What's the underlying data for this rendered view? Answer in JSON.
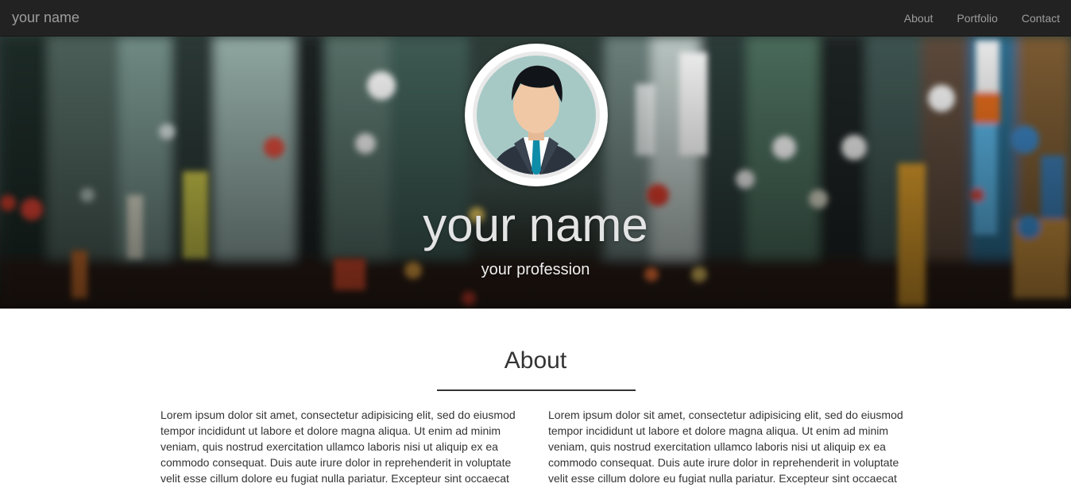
{
  "navbar": {
    "brand": "your name",
    "items": [
      {
        "label": "About"
      },
      {
        "label": "Portfolio"
      },
      {
        "label": "Contact"
      }
    ]
  },
  "hero": {
    "name": "your name",
    "profession": "your profession",
    "avatar_icon": "businessman-avatar-icon"
  },
  "about": {
    "title": "About",
    "left_text": "Lorem ipsum dolor sit amet, consectetur adipisicing elit, sed do eiusmod tempor incididunt ut labore et dolore magna aliqua. Ut enim ad minim veniam, quis nostrud exercitation ullamco laboris nisi ut aliquip ex ea commodo consequat. Duis aute irure dolor in reprehenderit in voluptate velit esse cillum dolore eu fugiat nulla pariatur. Excepteur sint occaecat",
    "right_text": "Lorem ipsum dolor sit amet, consectetur adipisicing elit, sed do eiusmod tempor incididunt ut labore et dolore magna aliqua. Ut enim ad minim veniam, quis nostrud exercitation ullamco laboris nisi ut aliquip ex ea commodo consequat. Duis aute irure dolor in reprehenderit in voluptate velit esse cillum dolore eu fugiat nulla pariatur. Excepteur sint occaecat"
  },
  "colors": {
    "navbar_bg": "#222222",
    "nav_text": "#9d9d9d",
    "body_text": "#333333"
  }
}
